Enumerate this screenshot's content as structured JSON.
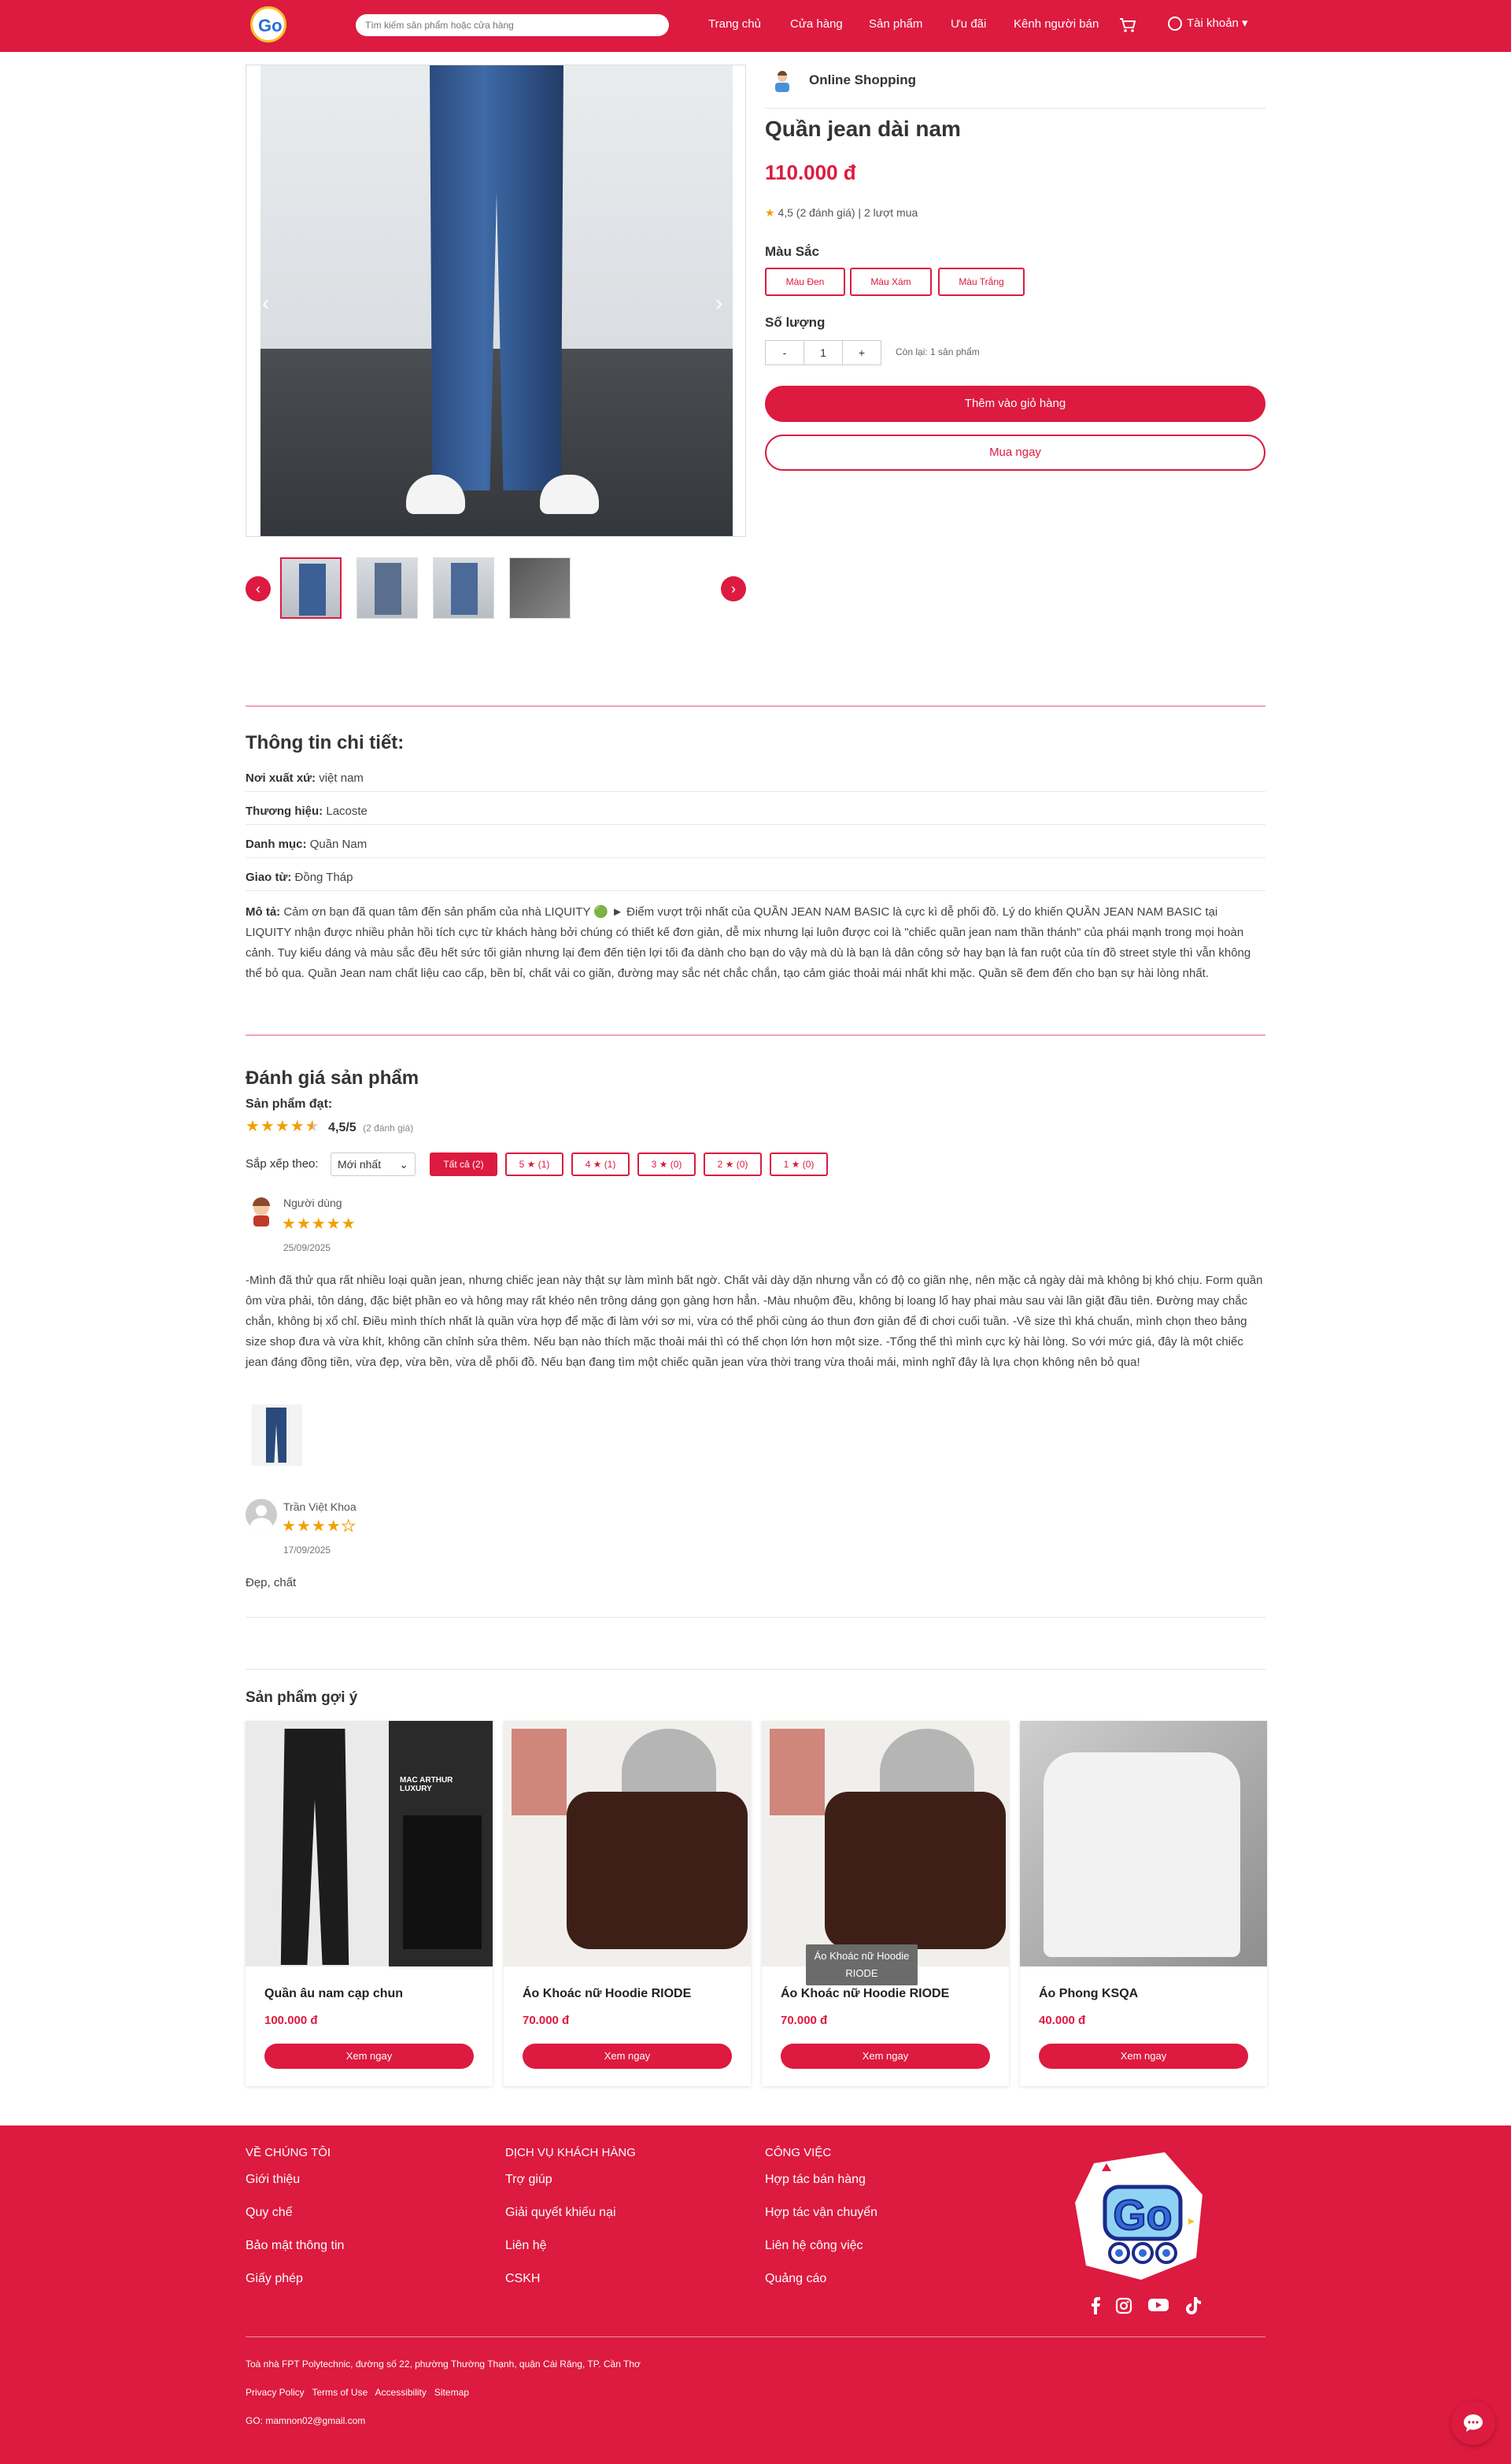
{
  "header": {
    "search_placeholder": "Tìm kiếm sản phẩm hoặc cửa hàng",
    "nav": [
      "Trang chủ",
      "Cửa hàng",
      "Sản phẩm",
      "Ưu đãi",
      "Kênh người bán"
    ],
    "account": "Tài khoản"
  },
  "product": {
    "shop_name": "Online Shopping",
    "title": "Quần jean dài nam",
    "price": "110.000 đ",
    "rating_text": "4,5 (2 đánh giá) | 2 lượt mua",
    "color_label": "Màu Sắc",
    "colors": [
      "Màu Đen",
      "Màu Xám",
      "Màu Trắng"
    ],
    "qty_label": "Số lượng",
    "qty_minus": "-",
    "qty_value": "1",
    "qty_plus": "+",
    "remain": "Còn lại: 1 sản phẩm",
    "add_to_cart": "Thêm vào giỏ hàng",
    "buy_now": "Mua ngay"
  },
  "details": {
    "heading": "Thông tin chi tiết:",
    "rows": [
      {
        "label": "Nơi xuất xứ:",
        "value": "việt nam"
      },
      {
        "label": "Thương hiệu:",
        "value": "Lacoste"
      },
      {
        "label": "Danh mục:",
        "value": "Quần Nam"
      },
      {
        "label": "Giao từ:",
        "value": "Đồng Tháp"
      }
    ],
    "desc_label": "Mô tả:",
    "desc_text": "Cảm ơn bạn đã quan tâm đến sản phẩm của nhà LIQUITY 🟢 ► Điểm vượt trội nhất của QUẦN JEAN NAM BASIC là cực kì dễ phối đồ. Lý do khiến QUẦN JEAN NAM BASIC tại LIQUITY nhận được nhiều phản hồi tích cực từ khách hàng bởi chúng có thiết kế đơn giản, dễ mix nhưng lại luôn được coi là \"chiếc quần jean nam thần thánh\" của phái mạnh trong mọi hoàn cảnh. Tuy kiểu dáng và màu sắc đều hết sức tối giản nhưng lại đem đến tiện lợi tối đa dành cho bạn do vậy mà dù là bạn là dân công sở hay bạn là fan ruột của tín đồ street style thì vẫn không thể bỏ qua. Quần Jean nam chất liệu cao cấp, bền bỉ, chất vải co giãn, đường may sắc nét chắc chắn, tạo cảm giác thoải mái nhất khi mặc. Quần sẽ đem đến cho bạn sự hài lòng nhất."
  },
  "reviews": {
    "heading": "Đánh giá sản phẩm",
    "achieved": "Sản phẩm đạt:",
    "score": "4,5/5",
    "count": "(2 đánh giá)",
    "sort_label": "Sắp xếp theo:",
    "sort_value": "Mới nhất",
    "filters": [
      "Tất cả (2)",
      "5 ★ (1)",
      "4 ★ (1)",
      "3 ★ (0)",
      "2 ★ (0)",
      "1 ★ (0)"
    ],
    "items": [
      {
        "name": "Người dùng",
        "stars": 5,
        "date": "25/09/2025",
        "text": "-Mình đã thử qua rất nhiều loại quần jean, nhưng chiếc jean này thật sự làm mình bất ngờ. Chất vải dày dặn nhưng vẫn có độ co giãn nhẹ, nên mặc cả ngày dài mà không bị khó chịu. Form quần ôm vừa phải, tôn dáng, đặc biệt phần eo và hông may rất khéo nên trông dáng gọn gàng hơn hẳn. -Màu nhuộm đều, không bị loang lổ hay phai màu sau vài lần giặt đầu tiên. Đường may chắc chắn, không bị xổ chỉ. Điều mình thích nhất là quần vừa hợp để mặc đi làm với sơ mi, vừa có thể phối cùng áo thun đơn giản để đi chơi cuối tuần. -Về size thì khá chuẩn, mình chọn theo bảng size shop đưa và vừa khít, không cần chỉnh sửa thêm. Nếu bạn nào thích mặc thoải mái thì có thể chọn lớn hơn một size. -Tổng thể thì mình cực kỳ hài lòng. So với mức giá, đây là một chiếc jean đáng đồng tiền, vừa đẹp, vừa bền, vừa dễ phối đồ. Nếu bạn đang tìm một chiếc quần jean vừa thời trang vừa thoải mái, mình nghĩ đây là lựa chọn không nên bỏ qua!"
      },
      {
        "name": "Trần Việt Khoa",
        "stars": 4,
        "date": "17/09/2025",
        "text": "Đẹp, chất"
      }
    ]
  },
  "suggest": {
    "heading": "Sản phẩm gợi ý",
    "items": [
      {
        "name": "Quần âu nam cạp chun",
        "price": "100.000 đ",
        "btn": "Xem ngay",
        "img_text": "MAC ARTHUR LUXURY"
      },
      {
        "name": "Áo Khoác nữ Hoodie RIODE",
        "price": "70.000 đ",
        "btn": "Xem ngay"
      },
      {
        "name": "Áo Khoác nữ Hoodie RIODE",
        "price": "70.000 đ",
        "btn": "Xem ngay"
      },
      {
        "name": "Áo Phong KSQA",
        "price": "40.000 đ",
        "btn": "Xem ngay"
      }
    ],
    "tooltip": "Áo Khoác nữ Hoodie RIODE"
  },
  "footer": {
    "cols": [
      {
        "title": "VỀ CHÚNG TÔI",
        "links": [
          "Giới thiệu",
          "Quy chế",
          "Bảo mật thông tin",
          "Giấy phép"
        ]
      },
      {
        "title": "DỊCH VỤ KHÁCH HÀNG",
        "links": [
          "Trợ giúp",
          "Giải quyết khiếu nại",
          "Liên hệ",
          "CSKH"
        ]
      },
      {
        "title": "CÔNG VIỆC",
        "links": [
          "Hợp tác bán hàng",
          "Hợp tác vận chuyển",
          "Liên hệ công việc",
          "Quảng cáo"
        ]
      }
    ],
    "address": "Toà nhà FPT Polytechnic, đường số 22, phường Thường Thạnh, quận Cái Răng, TP. Cần Thơ",
    "policy": [
      "Privacy Policy",
      "Terms of Use",
      "Accessibility",
      "Sitemap"
    ],
    "email": "GO: mamnon02@gmail.com",
    "logo_text": "Go"
  },
  "colors": {
    "brand": "#dd1a3f",
    "star": "#f0a000"
  }
}
